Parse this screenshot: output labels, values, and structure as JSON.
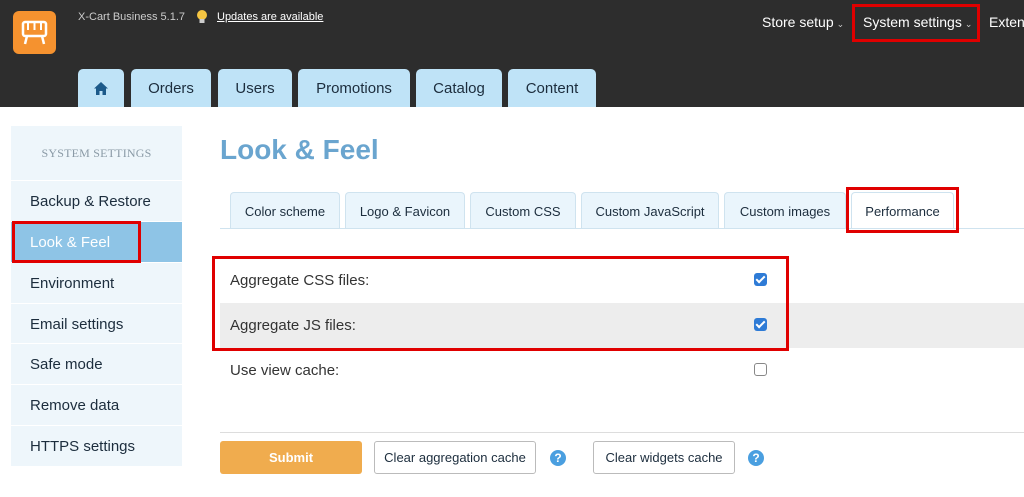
{
  "header": {
    "version": "X-Cart Business 5.1.7",
    "updates_link": "Updates are available",
    "nav": [
      {
        "label": "Store setup"
      },
      {
        "label": "System settings"
      },
      {
        "label": "Exten"
      }
    ],
    "tabs": [
      {
        "label": "Orders"
      },
      {
        "label": "Users"
      },
      {
        "label": "Promotions"
      },
      {
        "label": "Catalog"
      },
      {
        "label": "Content"
      }
    ]
  },
  "sidebar": {
    "heading": "SYSTEM SETTINGS",
    "items": [
      {
        "label": "Backup & Restore"
      },
      {
        "label": "Look & Feel"
      },
      {
        "label": "Environment"
      },
      {
        "label": "Email settings"
      },
      {
        "label": "Safe mode"
      },
      {
        "label": "Remove data"
      },
      {
        "label": "HTTPS settings"
      }
    ]
  },
  "main": {
    "title": "Look & Feel",
    "subtabs": [
      {
        "label": "Color scheme"
      },
      {
        "label": "Logo & Favicon"
      },
      {
        "label": "Custom CSS"
      },
      {
        "label": "Custom JavaScript"
      },
      {
        "label": "Custom images"
      },
      {
        "label": "Performance"
      }
    ],
    "settings": [
      {
        "label": "Aggregate CSS files:",
        "checked": true
      },
      {
        "label": "Aggregate JS files:",
        "checked": true
      },
      {
        "label": "Use view cache:",
        "checked": false
      }
    ],
    "actions": {
      "submit": "Submit",
      "clear_aggregation": "Clear aggregation cache",
      "clear_widgets": "Clear widgets cache",
      "help_glyph": "?"
    }
  },
  "colors": {
    "accent": "#f0ac4e",
    "tab_bg": "#bfe3f7",
    "sidebar_active": "#8ec4e6",
    "title": "#6aa5cf",
    "highlight": "#e00000"
  }
}
